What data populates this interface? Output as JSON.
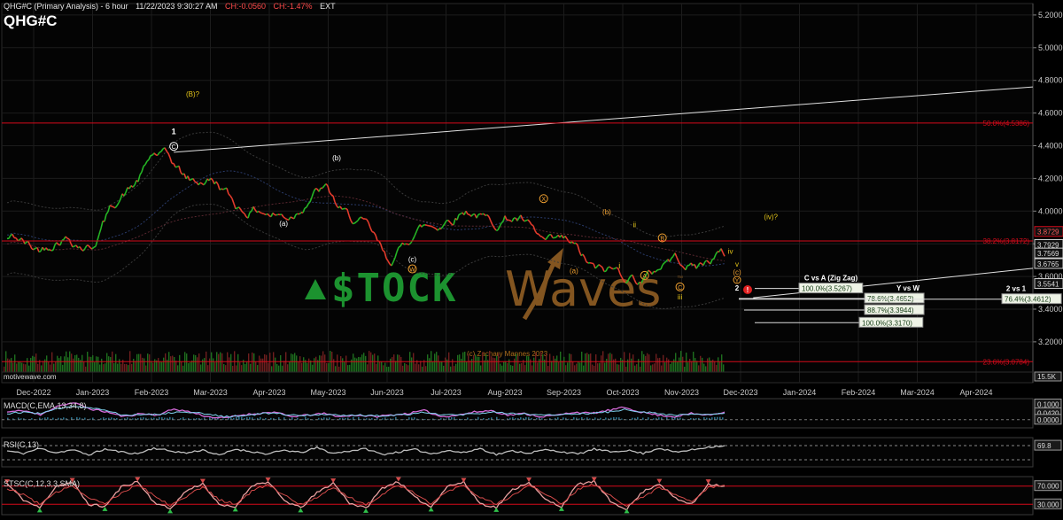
{
  "header": {
    "title": "QHG#C (Primary Analysis) - 6 hour",
    "datetime": "11/22/2023 9:30:27 AM",
    "change": "CH:-0.0560",
    "change_pct": "CH:-1.47%",
    "session": "EXT"
  },
  "symbol": "QHG#C",
  "source": "motivewave.com",
  "watermark": {
    "brand": "$TOCK",
    "brand2": "Waves",
    "tm": "™",
    "copyright": "(c) Zachary Mannes 2023"
  },
  "colors": {
    "up": "#25b525",
    "down": "#e33b2c",
    "fib": "#d40a1a",
    "wave": "#e6c619",
    "label": "#f0a030",
    "brand_green": "#1e9a32",
    "brand_brown": "#8a5a22",
    "macd": "#d46ad8",
    "signal": "#7fd3f0"
  },
  "chart_data": [
    {
      "panel": "price",
      "type": "line",
      "x_labels": [
        "Dec-2022",
        "Jan-2023",
        "Feb-2023",
        "Mar-2023",
        "Apr-2023",
        "May-2023",
        "Jun-2023",
        "Jul-2023",
        "Aug-2023",
        "Sep-2023",
        "Oct-2023",
        "Nov-2023",
        "Dec-2023",
        "Jan-2024",
        "Feb-2024",
        "Mar-2024",
        "Apr-2024"
      ],
      "ylim": [
        2.95,
        5.27
      ],
      "y_ticks": [
        "5.2000",
        "5.0000",
        "4.8000",
        "4.6000",
        "4.4000",
        "4.2000",
        "4.0000",
        "3.8000",
        "3.6000",
        "3.4000",
        "3.2000"
      ],
      "series": [
        {
          "x": [
            "Dec-2022",
            "Jan-2023",
            "Feb-2023",
            "Mar-2023",
            "Apr-2023",
            "May-2023",
            "Jun-2023",
            "Jul-2023",
            "Aug-2023",
            "Sep-2023",
            "Oct-2023",
            "Nov-2023"
          ],
          "values": [
            3.8,
            3.82,
            4.34,
            4.16,
            3.95,
            4.12,
            3.72,
            3.98,
            3.96,
            3.78,
            3.58,
            3.7
          ]
        }
      ],
      "price_labels": [
        {
          "text": "3.8729",
          "y": 3.8729,
          "color": "#d40a1a"
        },
        {
          "text": "3.7929",
          "y": 3.7929,
          "color": "#d0d0d0"
        },
        {
          "text": "3.7569",
          "y": 3.7569,
          "color": "#d0d0d0"
        },
        {
          "text": "3.6765",
          "y": 3.6765,
          "color": "#d0d0d0"
        },
        {
          "text": "3.5541",
          "y": 3.5541,
          "color": "#d0d0d0"
        }
      ],
      "fib_lines": [
        {
          "label": "50.0%(4.5386)",
          "y": 4.5386
        },
        {
          "label": "38.2%(3.8172)",
          "y": 3.8172
        },
        {
          "label": "23.6%(3.0784)",
          "y": 3.0784
        }
      ],
      "wave_labels": [
        {
          "text": "(B)?",
          "x": 6.3,
          "y": 4.7,
          "color": "#e6c619"
        },
        {
          "text": "1",
          "x": 5.55,
          "y": 4.47,
          "color": "#ffffff"
        },
        {
          "text": "C",
          "x": 5.55,
          "y": 4.38,
          "color": "#ffffff",
          "circle": true
        },
        {
          "text": "(a)",
          "x": 9.9,
          "y": 3.91,
          "color": "#ffffff"
        },
        {
          "text": "(b)",
          "x": 12.0,
          "y": 4.31,
          "color": "#ffffff"
        },
        {
          "text": "(c)",
          "x": 15.0,
          "y": 3.69,
          "color": "#ffffff"
        },
        {
          "text": "W",
          "x": 15.0,
          "y": 3.63,
          "color": "#f0a030",
          "circle": true
        },
        {
          "text": "X",
          "x": 20.2,
          "y": 4.06,
          "color": "#f0a030",
          "circle": true
        },
        {
          "text": "(b)",
          "x": 22.7,
          "y": 3.98,
          "color": "#f0a030"
        },
        {
          "text": "(a)",
          "x": 21.4,
          "y": 3.62,
          "color": "#f0a030"
        },
        {
          "text": "ii",
          "x": 23.8,
          "y": 3.9,
          "color": "#e6c619"
        },
        {
          "text": "i",
          "x": 23.2,
          "y": 3.65,
          "color": "#e6c619"
        },
        {
          "text": "B",
          "x": 24.9,
          "y": 3.82,
          "color": "#f0a030",
          "circle": true
        },
        {
          "text": "A",
          "x": 24.2,
          "y": 3.59,
          "color": "#f0a030",
          "circle": true
        },
        {
          "text": "iv",
          "x": 27.6,
          "y": 3.74,
          "color": "#e6c619"
        },
        {
          "text": "C",
          "x": 25.6,
          "y": 3.52,
          "color": "#f0a030",
          "circle": true
        },
        {
          "text": "iii",
          "x": 25.6,
          "y": 3.46,
          "color": "#e6c619"
        },
        {
          "text": "(iv)?",
          "x": 29.2,
          "y": 3.95,
          "color": "#e6c619"
        }
      ],
      "target_labels": [
        {
          "text": "v",
          "color": "#e6c619"
        },
        {
          "text": "(c)",
          "color": "#f0a030"
        },
        {
          "text": "Y",
          "color": "#f0a030",
          "circle": true
        },
        {
          "text": "2",
          "color": "#ffffff"
        }
      ],
      "projections": [
        {
          "title": "C vs A (Zig Zag)",
          "label": "100.0%(3.5267)",
          "y": 3.5267
        },
        {
          "title": "Y vs W",
          "label": "78.6%(3.4652)",
          "y": 3.4652
        },
        {
          "title": "",
          "label": "88.7%(3.3944)",
          "y": 3.3944
        },
        {
          "title": "",
          "label": "100.0%(3.3170)",
          "y": 3.317
        },
        {
          "title": "2 vs 1",
          "label": "76.4%(3.4612)",
          "y": 3.4612
        }
      ],
      "volume_label": "15.5K"
    },
    {
      "panel": "macd",
      "type": "line",
      "title": "MACD(C,EMA,13,34,8)",
      "ylim": [
        -0.03,
        0.12
      ],
      "y_ticks": [
        "0.1000",
        "0.0420",
        "0.0000"
      ],
      "series": [
        {
          "name": "MACD",
          "values": [
            0.05,
            0.06,
            0.03,
            0.09,
            0.11,
            0.07,
            0.05,
            0.02,
            0.04,
            0.03,
            0.07,
            0.05,
            0.02,
            0.01,
            0.03,
            0.04,
            0.05,
            0.02,
            0.03,
            0.04,
            0.02,
            0.03,
            0.02,
            0.03,
            0.04,
            0.06,
            0.02,
            0.03,
            0.05,
            0.06,
            0.03,
            0.04,
            0.02,
            0.03,
            0.05,
            0.04,
            0.06,
            0.08,
            0.05,
            0.03,
            0.02,
            0.04,
            0.03,
            0.05
          ]
        },
        {
          "name": "Signal",
          "values": [
            0.04,
            0.05,
            0.04,
            0.07,
            0.09,
            0.08,
            0.06,
            0.03,
            0.035,
            0.035,
            0.05,
            0.05,
            0.035,
            0.02,
            0.025,
            0.035,
            0.045,
            0.03,
            0.03,
            0.035,
            0.03,
            0.03,
            0.025,
            0.03,
            0.035,
            0.05,
            0.035,
            0.03,
            0.04,
            0.05,
            0.04,
            0.04,
            0.03,
            0.03,
            0.04,
            0.04,
            0.05,
            0.065,
            0.055,
            0.04,
            0.03,
            0.035,
            0.035,
            0.042
          ]
        }
      ]
    },
    {
      "panel": "rsi",
      "type": "line",
      "title": "RSI(C,13)",
      "ylim": [
        20,
        85
      ],
      "y_ticks": [
        "69.8"
      ],
      "series": [
        {
          "name": "RSI",
          "values": [
            55,
            48,
            62,
            50,
            58,
            44,
            60,
            52,
            47,
            63,
            55,
            49,
            58,
            42,
            60,
            53,
            46,
            57,
            50,
            64,
            48,
            55,
            61,
            45,
            52,
            59,
            47,
            56,
            50,
            62,
            45,
            55,
            49,
            58,
            53,
            46,
            60,
            52,
            57,
            48,
            63,
            51,
            58,
            66,
            69.8
          ]
        }
      ]
    },
    {
      "panel": "stoch",
      "type": "line",
      "title": "STSC(C,12,3,3,SMA)",
      "ylim": [
        15,
        85
      ],
      "y_ticks": [
        "70.000",
        "30.000"
      ],
      "series": [
        {
          "name": "K",
          "values": [
            75,
            40,
            22,
            70,
            78,
            30,
            25,
            68,
            80,
            35,
            20,
            60,
            76,
            28,
            24,
            72,
            79,
            38,
            22,
            55,
            77,
            33,
            21,
            66,
            80,
            45,
            24,
            70,
            78,
            32,
            23,
            62,
            79,
            40,
            25,
            74,
            80,
            36,
            20,
            58,
            76,
            42,
            30,
            75,
            70
          ]
        },
        {
          "name": "D",
          "values": [
            65,
            52,
            30,
            55,
            72,
            45,
            32,
            55,
            74,
            50,
            28,
            48,
            68,
            40,
            30,
            58,
            74,
            50,
            30,
            45,
            68,
            45,
            28,
            52,
            73,
            55,
            32,
            58,
            72,
            45,
            30,
            50,
            72,
            52,
            32,
            62,
            74,
            48,
            28,
            46,
            68,
            50,
            36,
            66,
            72
          ]
        }
      ]
    }
  ]
}
